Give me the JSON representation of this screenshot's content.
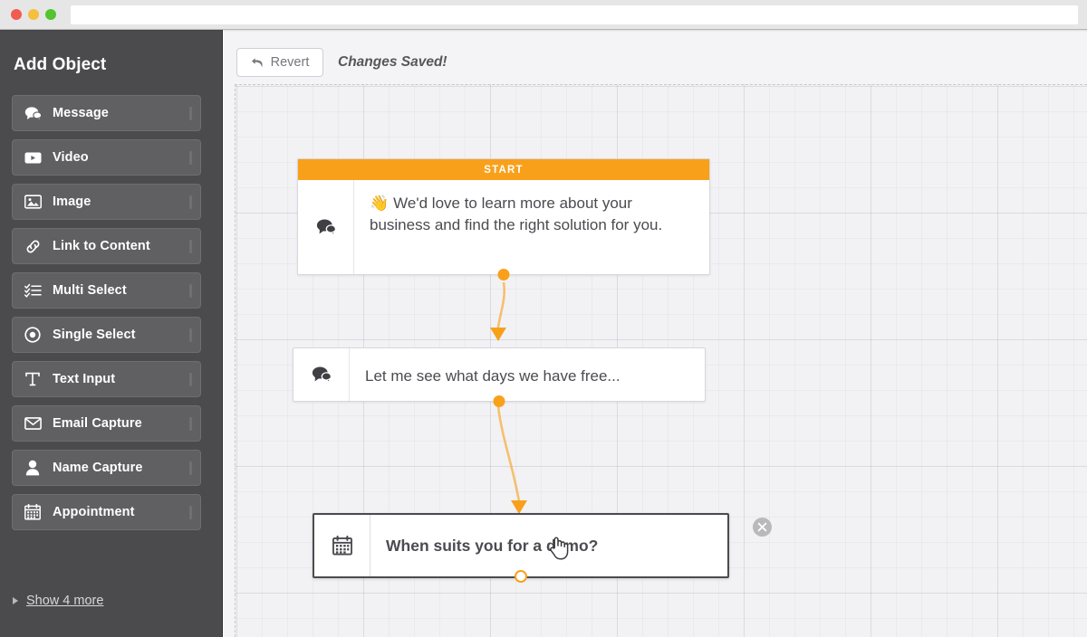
{
  "window": {
    "traffic_lights": [
      "close",
      "minimize",
      "zoom"
    ],
    "url_value": "",
    "url_placeholder": ""
  },
  "sidebar": {
    "title": "Add Object",
    "items": [
      {
        "label": "Message",
        "icon": "speech-bubbles-icon"
      },
      {
        "label": "Video",
        "icon": "video-play-icon"
      },
      {
        "label": "Image",
        "icon": "picture-icon"
      },
      {
        "label": "Link to Content",
        "icon": "link-chain-icon"
      },
      {
        "label": "Multi Select",
        "icon": "checklist-icon"
      },
      {
        "label": "Single Select",
        "icon": "radio-button-icon"
      },
      {
        "label": "Text Input",
        "icon": "text-t-icon"
      },
      {
        "label": "Email Capture",
        "icon": "envelope-icon"
      },
      {
        "label": "Name Capture",
        "icon": "person-icon"
      },
      {
        "label": "Appointment",
        "icon": "calendar-icon"
      }
    ],
    "show_more": {
      "label": "Show 4 more",
      "icon": "triangle-right-icon"
    }
  },
  "toolbar": {
    "revert_label": "Revert",
    "revert_icon": "undo-arrow-icon",
    "status_message": "Changes Saved!"
  },
  "canvas": {
    "nodes": [
      {
        "id": "node-start",
        "header": "START",
        "icon": "speech-bubbles-icon",
        "emoji": "👋",
        "text": "We'd love to learn more about your business and find the right solution for you.",
        "selected": false,
        "bold": false
      },
      {
        "id": "node-message-2",
        "header": "",
        "icon": "speech-bubbles-icon",
        "emoji": "",
        "text": "Let me see what days we have free...",
        "selected": false,
        "bold": false
      },
      {
        "id": "node-appointment",
        "header": "",
        "icon": "calendar-icon",
        "emoji": "",
        "text": "When suits you for a demo?",
        "selected": true,
        "bold": true,
        "close_icon": "close-circle-icon"
      }
    ],
    "connectors": [
      {
        "from": "node-start",
        "to": "node-message-2"
      },
      {
        "from": "node-message-2",
        "to": "node-appointment"
      }
    ],
    "cursor": "pointing-hand-cursor"
  },
  "colors": {
    "accent": "#f9a01b",
    "sidebar_bg": "#4b4b4e",
    "canvas_bg": "#f2f2f5",
    "node_border_selected": "#4a4a4f",
    "text_dark": "#4b4b50"
  }
}
